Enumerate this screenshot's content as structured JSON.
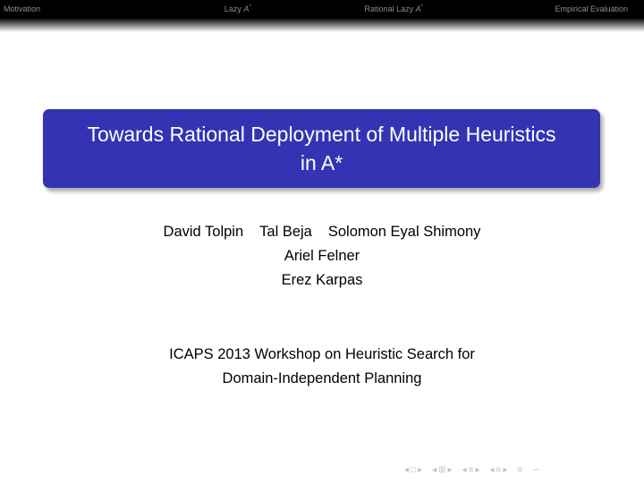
{
  "nav": {
    "items": [
      {
        "label": "Motivation"
      },
      {
        "label": "Lazy ",
        "italic": "A",
        "sup": "*"
      },
      {
        "label": "Rational Lazy ",
        "italic": "A",
        "sup": "*"
      },
      {
        "label": "Empirical Evaluation"
      }
    ]
  },
  "slide": {
    "title_line1": "Towards Rational Deployment of Multiple Heuristics",
    "title_line2": "in A*",
    "authors_line1": [
      "David Tolpin",
      "Tal Beja",
      "Solomon Eyal Shimony"
    ],
    "authors_line2": "Ariel Felner",
    "authors_line3": "Erez Karpas",
    "venue_line1": "ICAPS 2013 Workshop on Heuristic Search for",
    "venue_line2": "Domain-Independent Planning"
  },
  "controls": {
    "first": "◂",
    "frame_icon": "□",
    "next": "▸",
    "section_icon": "⊞",
    "subsection_icon": "≡",
    "align_icon": "≡",
    "search_icon": "∽"
  },
  "colors": {
    "title_bg": "#3333b3",
    "nav_bg": "#000000",
    "nav_text": "#8c8c8c"
  }
}
